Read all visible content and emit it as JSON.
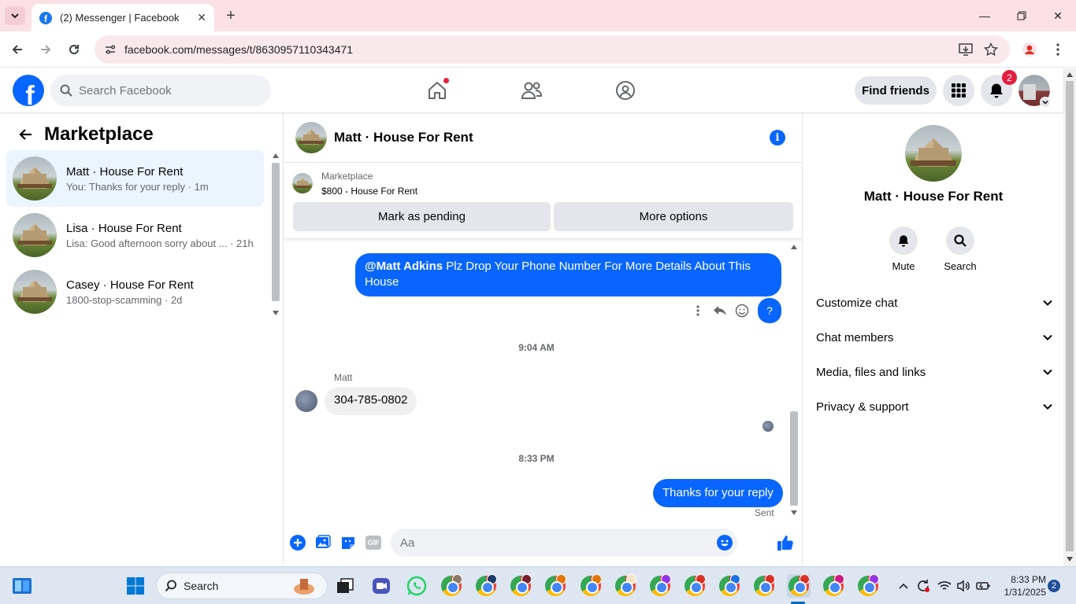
{
  "browser": {
    "tab_title": "(2) Messenger | Facebook",
    "url": "facebook.com/messages/t/8630957110343471"
  },
  "fb_header": {
    "search_placeholder": "Search Facebook",
    "find_friends": "Find friends",
    "notification_count": "2"
  },
  "left_panel": {
    "title": "Marketplace",
    "conversations": [
      {
        "name": "Matt · House For Rent",
        "preview": "You: Thanks for your reply · 1m",
        "active": true
      },
      {
        "name": "Lisa · House For Rent",
        "preview": "Lisa: Good afternoon sorry about ... · 21h",
        "active": false
      },
      {
        "name": "Casey · House For Rent",
        "preview": "1800-stop-scamming · 2d",
        "active": false
      }
    ]
  },
  "chat": {
    "title": "Matt · House For Rent",
    "marketplace_label": "Marketplace",
    "listing": "$800 - House For Rent",
    "mark_pending": "Mark as pending",
    "more_options": "More options",
    "messages": {
      "outgoing_1_mention": "@Matt Adkins",
      "outgoing_1_text": " Plz Drop Your Phone Number For More Details About This House",
      "question_mark": "?",
      "time_1": "9:04 AM",
      "sender_matt": "Matt",
      "incoming_1": "304-785-0802",
      "time_2": "8:33 PM",
      "outgoing_2": "Thanks for your reply",
      "status": "Sent"
    },
    "composer_placeholder": "Aa",
    "gif_label": "GIF"
  },
  "right_panel": {
    "name": "Matt · House For Rent",
    "actions": [
      {
        "label": "Mute",
        "icon": "bell-icon"
      },
      {
        "label": "Search",
        "icon": "search-icon"
      }
    ],
    "sections": [
      {
        "label": "Customize chat"
      },
      {
        "label": "Chat members"
      },
      {
        "label": "Media, files and links"
      },
      {
        "label": "Privacy & support"
      }
    ]
  },
  "taskbar": {
    "search_label": "Search",
    "time": "8:33 PM",
    "date": "1/31/2025",
    "notification_count": "2"
  },
  "colors": {
    "fb_blue": "#0866ff",
    "tab_strip": "#fbe1e6",
    "active_convo": "#ebf5ff",
    "notification_red": "#e41e3f"
  }
}
